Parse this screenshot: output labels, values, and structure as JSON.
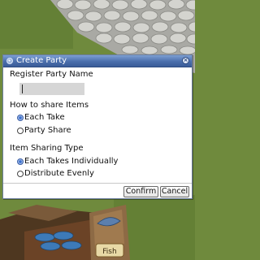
{
  "dialog": {
    "title": "Create Party",
    "register_label": "Register Party Name",
    "name_value": "",
    "share_items_label": "How to share Items",
    "share_options": [
      {
        "label": "Each Take",
        "selected": true
      },
      {
        "label": "Party Share",
        "selected": false
      }
    ],
    "sharing_type_label": "Item Sharing Type",
    "sharing_type_options": [
      {
        "label": "Each Takes Individually",
        "selected": true
      },
      {
        "label": "Distribute Evenly",
        "selected": false
      }
    ],
    "confirm_label": "Confirm",
    "cancel_label": "Cancel"
  },
  "scene": {
    "sign_text": "Fish",
    "colors": {
      "grass": "#6f8a3d",
      "stone": "#c9c9c9",
      "wood": "#6b4326"
    }
  }
}
